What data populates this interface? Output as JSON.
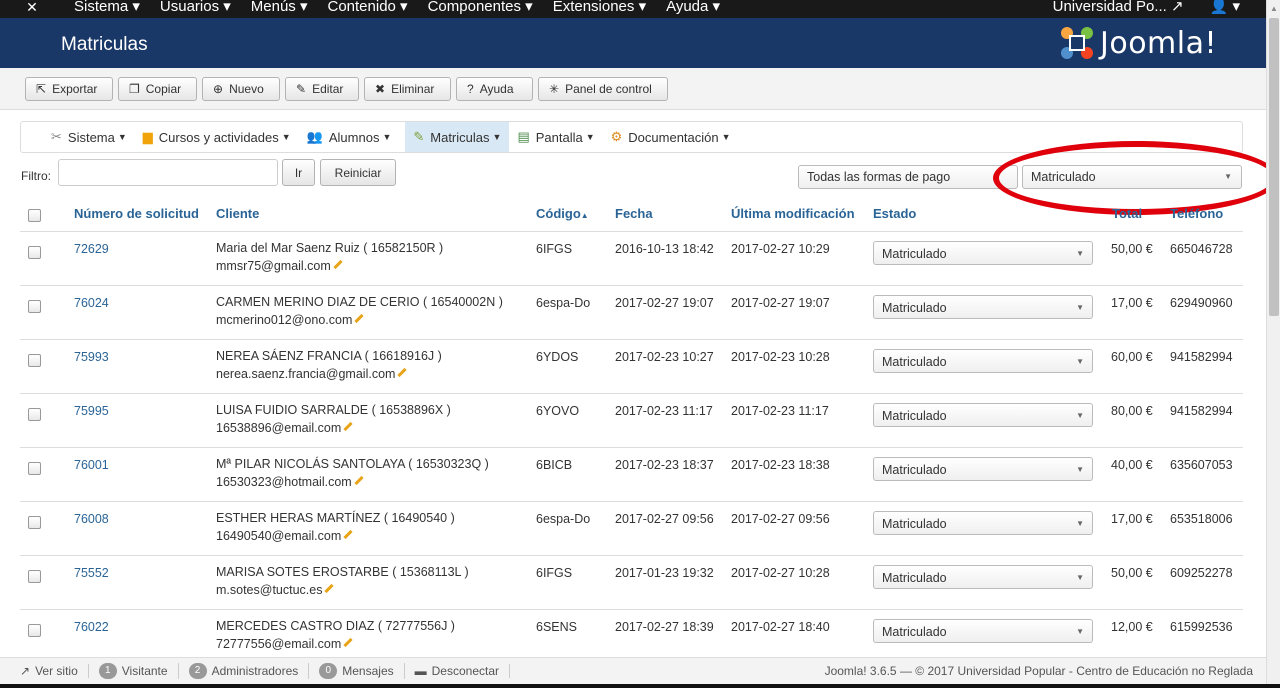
{
  "topbar": {
    "menu": [
      "Sistema ▾",
      "Usuarios ▾",
      "Menús ▾",
      "Contenido ▾",
      "Componentes ▾",
      "Extensiones ▾",
      "Ayuda ▾"
    ],
    "site_name": "Universidad Po...",
    "user_menu": "▾"
  },
  "header": {
    "title": "Matriculas",
    "brand": "Joomla!"
  },
  "toolbar": {
    "exportar": "Exportar",
    "copiar": "Copiar",
    "nuevo": "Nuevo",
    "editar": "Editar",
    "eliminar": "Eliminar",
    "ayuda": "Ayuda",
    "panel": "Panel de control"
  },
  "subnav": {
    "items": [
      {
        "label": "Sistema"
      },
      {
        "label": "Cursos y actividades"
      },
      {
        "label": "Alumnos"
      },
      {
        "label": "Matriculas"
      },
      {
        "label": "Pantalla"
      },
      {
        "label": "Documentación"
      }
    ]
  },
  "filter": {
    "label": "Filtro:",
    "value": "",
    "go_label": "Ir",
    "reset_label": "Reiniciar",
    "payment_select": "Todas las formas de pago",
    "status_select": "Matriculado"
  },
  "table": {
    "headers": {
      "numero": "Número de solicitud",
      "cliente": "Cliente",
      "codigo": "Código",
      "fecha": "Fecha",
      "ultima": "Última modificación",
      "estado": "Estado",
      "total": "Total",
      "telefono": "Teléfono"
    },
    "rows": [
      {
        "id": "72629",
        "name": "Maria del Mar Saenz Ruiz ( 16582150R )",
        "email": "mmsr75@gmail.com",
        "codigo": "6IFGS",
        "fecha": "2016-10-13 18:42",
        "ultima": "2017-02-27 10:29",
        "estado": "Matriculado",
        "total": "50,00 €",
        "telefono": "665046728"
      },
      {
        "id": "76024",
        "name": "CARMEN MERINO DIAZ DE CERIO ( 16540002N )",
        "email": "mcmerino012@ono.com",
        "codigo": "6espa-Do",
        "fecha": "2017-02-27 19:07",
        "ultima": "2017-02-27 19:07",
        "estado": "Matriculado",
        "total": "17,00 €",
        "telefono": "629490960"
      },
      {
        "id": "75993",
        "name": "NEREA SÁENZ FRANCIA ( 16618916J )",
        "email": "nerea.saenz.francia@gmail.com",
        "codigo": "6YDOS",
        "fecha": "2017-02-23 10:27",
        "ultima": "2017-02-23 10:28",
        "estado": "Matriculado",
        "total": "60,00 €",
        "telefono": "941582994"
      },
      {
        "id": "75995",
        "name": "LUISA FUIDIO SARRALDE ( 16538896X )",
        "email": "16538896@email.com",
        "codigo": "6YOVO",
        "fecha": "2017-02-23 11:17",
        "ultima": "2017-02-23 11:17",
        "estado": "Matriculado",
        "total": "80,00 €",
        "telefono": "941582994"
      },
      {
        "id": "76001",
        "name": "Mª PILAR NICOLÁS SANTOLAYA ( 16530323Q )",
        "email": "16530323@hotmail.com",
        "codigo": "6BICB",
        "fecha": "2017-02-23 18:37",
        "ultima": "2017-02-23 18:38",
        "estado": "Matriculado",
        "total": "40,00 €",
        "telefono": "635607053"
      },
      {
        "id": "76008",
        "name": "ESTHER HERAS MARTÍNEZ ( 16490540 )",
        "email": "16490540@email.com",
        "codigo": "6espa-Do",
        "fecha": "2017-02-27 09:56",
        "ultima": "2017-02-27 09:56",
        "estado": "Matriculado",
        "total": "17,00 €",
        "telefono": "653518006"
      },
      {
        "id": "75552",
        "name": "MARISA SOTES EROSTARBE ( 15368113L )",
        "email": "m.sotes@tuctuc.es",
        "codigo": "6IFGS",
        "fecha": "2017-01-23 19:32",
        "ultima": "2017-02-27 10:28",
        "estado": "Matriculado",
        "total": "50,00 €",
        "telefono": "609252278"
      },
      {
        "id": "76022",
        "name": "MERCEDES CASTRO DIAZ ( 72777556J )",
        "email": "72777556@email.com",
        "codigo": "6SENS",
        "fecha": "2017-02-27 18:39",
        "ultima": "2017-02-27 18:40",
        "estado": "Matriculado",
        "total": "12,00 €",
        "telefono": "615992536"
      }
    ]
  },
  "footer": {
    "ver_sitio": "Ver sitio",
    "visitantes_count": "1",
    "visitantes": "Visitante",
    "admins_count": "2",
    "admins": "Administradores",
    "mensajes_count": "0",
    "mensajes": "Mensajes",
    "desconectar": "Desconectar",
    "copyright": "Joomla! 3.6.5 — © 2017 Universidad Popular - Centro de Educación no Reglada"
  }
}
